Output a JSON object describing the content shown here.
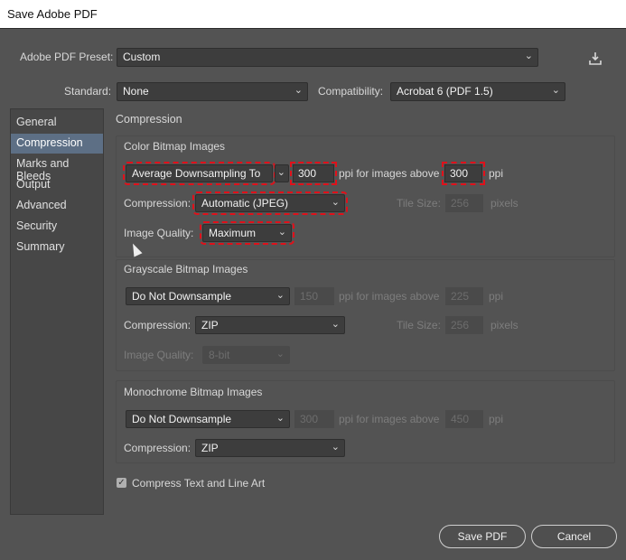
{
  "window": {
    "title": "Save Adobe PDF"
  },
  "preset": {
    "label": "Adobe PDF Preset:",
    "value": "Custom"
  },
  "save_preset_icon": "download-icon",
  "standard": {
    "label": "Standard:",
    "value": "None"
  },
  "compatibility": {
    "label": "Compatibility:",
    "value": "Acrobat 6 (PDF 1.5)"
  },
  "sidebar": {
    "items": [
      {
        "label": "General"
      },
      {
        "label": "Compression",
        "selected": true
      },
      {
        "label": "Marks and Bleeds"
      },
      {
        "label": "Output"
      },
      {
        "label": "Advanced"
      },
      {
        "label": "Security"
      },
      {
        "label": "Summary"
      }
    ]
  },
  "panel": {
    "title": "Compression"
  },
  "color": {
    "heading": "Color Bitmap Images",
    "downsample": "Average Downsampling To",
    "ppi": "300",
    "ppi_text": "ppi for images above",
    "above": "300",
    "ppi_unit": "ppi",
    "compression_label": "Compression:",
    "compression": "Automatic (JPEG)",
    "tile_label": "Tile Size:",
    "tile": "256",
    "tile_unit": "pixels",
    "quality_label": "Image Quality:",
    "quality": "Maximum"
  },
  "gray": {
    "heading": "Grayscale Bitmap Images",
    "downsample": "Do Not Downsample",
    "ppi": "150",
    "ppi_text": "ppi for images above",
    "above": "225",
    "ppi_unit": "ppi",
    "compression_label": "Compression:",
    "compression": "ZIP",
    "tile_label": "Tile Size:",
    "tile": "256",
    "tile_unit": "pixels",
    "quality_label": "Image Quality:",
    "quality": "8-bit"
  },
  "mono": {
    "heading": "Monochrome Bitmap Images",
    "downsample": "Do Not Downsample",
    "ppi": "300",
    "ppi_text": "ppi for images above",
    "above": "450",
    "ppi_unit": "ppi",
    "compression_label": "Compression:",
    "compression": "ZIP"
  },
  "compress_text": {
    "label": "Compress Text and Line Art",
    "checked": true
  },
  "buttons": {
    "save": "Save PDF",
    "cancel": "Cancel"
  }
}
